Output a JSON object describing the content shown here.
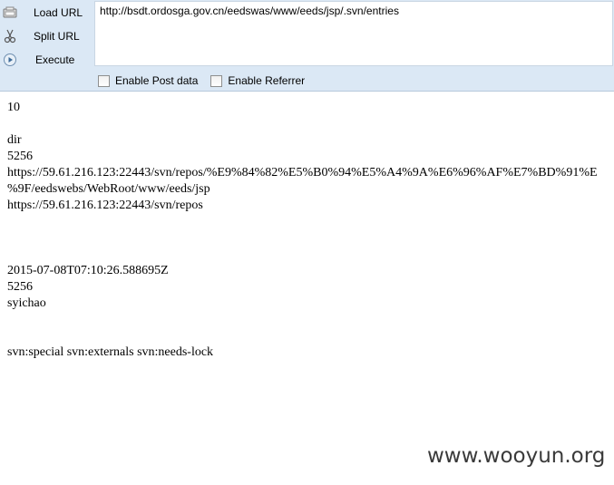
{
  "toolbar": {
    "load_url_label": "Load URL",
    "split_url_label": "Split URL",
    "execute_label": "Execute",
    "url_value": "http://bsdt.ordosga.gov.cn/eedswas/www/eeds/jsp/.svn/entries",
    "enable_post_label": "Enable Post data",
    "enable_referrer_label": "Enable Referrer"
  },
  "page": {
    "lines": [
      "10",
      "",
      "dir",
      "5256",
      "https://59.61.216.123:22443/svn/repos/%E9%84%82%E5%B0%94%E5%A4%9A%E6%96%AF%E7%BD%91%E",
      "%9F/eedswebs/WebRoot/www/eeds/jsp",
      "https://59.61.216.123:22443/svn/repos",
      "",
      "",
      "",
      "2015-07-08T07:10:26.588695Z",
      "5256",
      "syichao",
      "",
      "",
      "svn:special svn:externals svn:needs-lock"
    ]
  },
  "watermark": "www.wooyun.org"
}
